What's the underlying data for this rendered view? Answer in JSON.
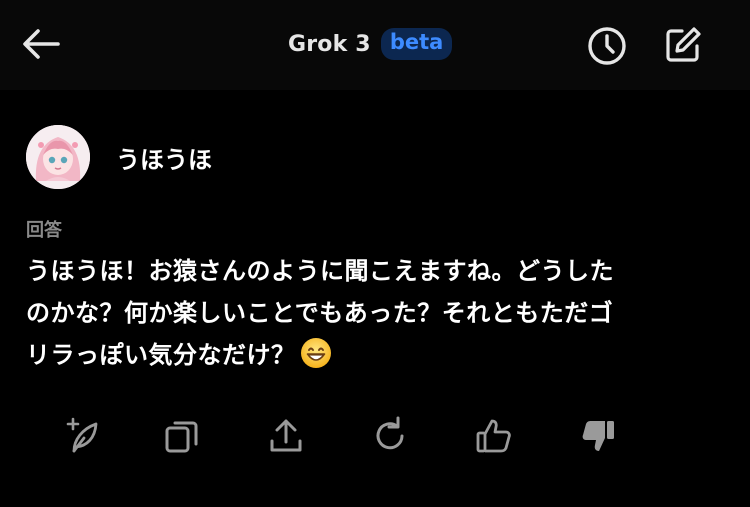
{
  "header": {
    "title": "Grok 3",
    "badge": "beta",
    "icons": [
      "back-arrow-icon",
      "history-clock-icon",
      "new-chat-compose-icon"
    ]
  },
  "user_message": {
    "text": "うほうほ"
  },
  "answer": {
    "label": "回答",
    "lines": [
      "うほうほ！お猿さんのように聞こえますね。どうした",
      "のかな？何か楽しいことでもあった？それともただゴ",
      "リラっぽい気分なだけ？"
    ],
    "emoji": "grinning-face-emoji"
  },
  "actions": {
    "icons": [
      "regenerate-spark-icon",
      "copy-icon",
      "share-icon",
      "refresh-icon",
      "thumbs-up-icon",
      "thumbs-down-icon"
    ]
  },
  "colors": {
    "background": "#000000",
    "header_background": "#080808",
    "badge_bg": "#0c2750",
    "badge_text": "#3d8bff",
    "label_gray": "#8a8a8a",
    "icon_gray": "#9a9a9a"
  }
}
